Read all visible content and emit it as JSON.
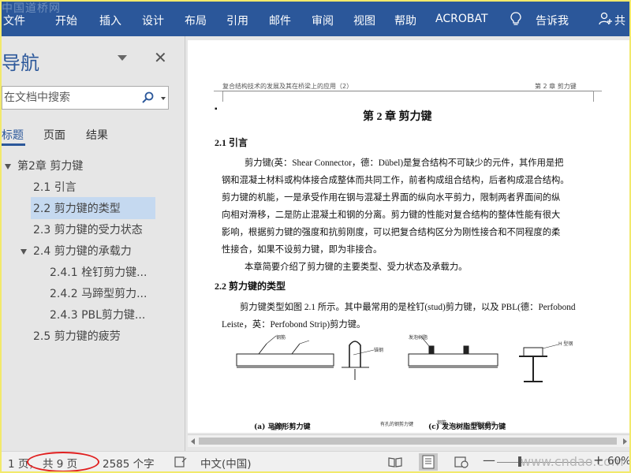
{
  "watermark_top": "中国道桥网",
  "ribbon": {
    "tabs": [
      "文件",
      "开始",
      "插入",
      "设计",
      "布局",
      "引用",
      "邮件",
      "审阅",
      "视图",
      "帮助",
      "ACROBAT"
    ],
    "tell_me": "告诉我",
    "share": "共"
  },
  "nav": {
    "title": "导航",
    "search_placeholder": "在文档中搜索",
    "tabs": [
      "标题",
      "页面",
      "结果"
    ],
    "tree": [
      {
        "label": "第2章  剪力键",
        "level": 0,
        "collapsible": true
      },
      {
        "label": "2.1 引言",
        "level": 1
      },
      {
        "label": "2.2 剪力键的类型",
        "level": 1,
        "selected": true
      },
      {
        "label": "2.3 剪力键的受力状态",
        "level": 1
      },
      {
        "label": "2.4 剪力键的承载力",
        "level": 1,
        "collapsible": true
      },
      {
        "label": "2.4.1  栓钉剪力键...",
        "level": 2
      },
      {
        "label": "2.4.2  马蹄型剪力...",
        "level": 2
      },
      {
        "label": "2.4.3   PBL剪力键...",
        "level": 2
      },
      {
        "label": "2.5 剪力键的疲劳",
        "level": 1
      }
    ]
  },
  "document": {
    "header_left": "复合结构技术的发展及其在桥梁上的应用（2）",
    "header_right": "第 2 章  剪力键",
    "chapter_title": "第 2 章   剪力键",
    "section_2_1": "2.1  引言",
    "para1": [
      "剪力键(英：Shear Connector，德：Dübel)是复合结构不可缺少的元件，其作用是把",
      "钢和混凝土材料或构体接合成整体而共同工作，前者构成组合结构，后者构成混合结构。",
      "剪力键的机能，一是承受作用在钢与混凝土界面的纵向水平剪力，限制两者界面间的纵",
      "向相对滑移，二是防止混凝土和钢的分离。剪力键的性能对复合结构的整体性能有很大",
      "影响，根据剪力键的强度和抗剪刚度，可以把复合结构区分为刚性接合和不同程度的柔",
      "性接合，如果不设剪力键，即为非接合。"
    ],
    "para2": "本章简要介绍了剪力键的主要类型、受力状态及承载力。",
    "section_2_2": "2.2  剪力键的类型",
    "para3": [
      "剪力键类型如图 2.1 所示。其中最常用的是栓钉(stud)剪力键，以及 PBL(德：Perfobond",
      "Leiste，英：Perfobond Strip)剪力键。"
    ],
    "fig_labels": {
      "a_caption": "(a)  马蹄形剪力键",
      "c_caption": "(c)  发泡树脂型钢剪力键",
      "l1": "钢筋",
      "l2": "锚钢",
      "l3": "发泡树脂",
      "l4": "H 型钢",
      "l5": "有孔的钢剪力键",
      "l6": "钢筋",
      "l7": "钢筋上贯通",
      "l8": "栓钉"
    }
  },
  "status": {
    "page_a": "1 页，",
    "page_b": "共 9 页",
    "words": "2585 个字",
    "language": "中文(中国)",
    "zoom": "60%",
    "watermark": "www.cndao.com"
  },
  "colors": {
    "ribbon": "#2b579a",
    "highlight": "#e02020",
    "selection": "#c5d9f0",
    "outer_frame": "#f2e96b"
  }
}
